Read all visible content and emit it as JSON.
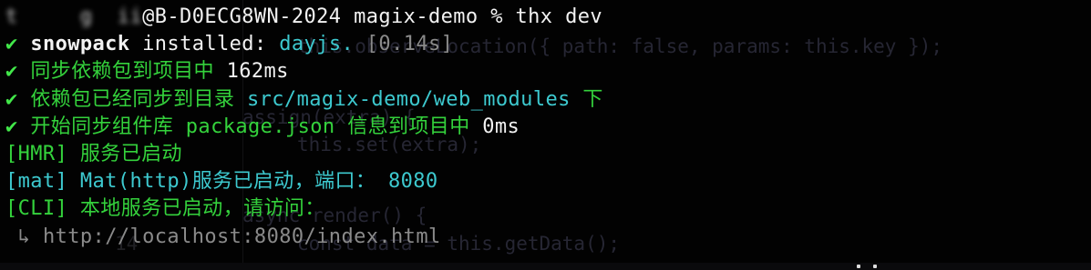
{
  "prompt": {
    "host_user": "@B-D0ECG8WN-2024",
    "cwd": "magix-demo",
    "symbol": "%",
    "command": "thx dev"
  },
  "output": {
    "snowpack": {
      "check": "✔",
      "name": "snowpack",
      "text": "installed:",
      "pkg": "dayjs.",
      "time": "[0.14s]"
    },
    "sync_deps": {
      "check": "✔",
      "text": "同步依赖包到项目中",
      "time": "162ms"
    },
    "synced_dir": {
      "check": "✔",
      "text": "依赖包已经同步到目录",
      "path": "src/magix-demo/web_modules",
      "suffix": "下"
    },
    "start_lib": {
      "check": "✔",
      "text": "开始同步组件库",
      "file": "package.json",
      "text2": "信息到项目中",
      "time": "0ms"
    },
    "hmr": {
      "tag": "[HMR]",
      "text": "服务已启动"
    },
    "mat": {
      "tag": "[mat]",
      "text": "Mat(http)服务已启动，端口：",
      "port": "8080"
    },
    "cli": {
      "tag": "[CLI]",
      "text": "本地服务已启动，请访问："
    },
    "url": {
      "arrow": "↳",
      "href": "http://localhost:8080/index.html"
    }
  },
  "background_code": {
    "line1": "this.observeLocation({ path: false, params: this.key });",
    "line2": "assign(extra) {",
    "line3": "this.set(extra);",
    "line4": "async render() {",
    "line5": "const data = this.getData();",
    "line_number": "14"
  },
  "colors": {
    "background": "#020202",
    "white": "#f2f2f2",
    "green": "#34d23c",
    "cyan": "#3dc9cf",
    "gray": "#8a8a8a"
  }
}
